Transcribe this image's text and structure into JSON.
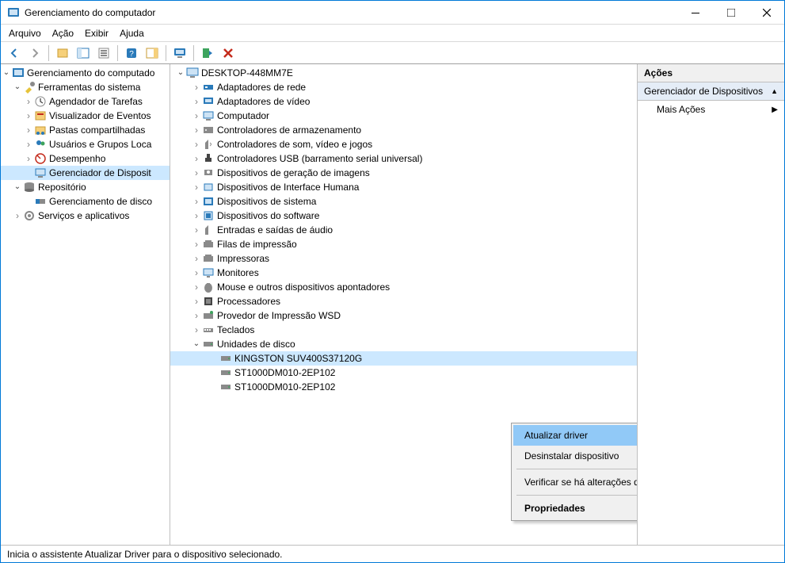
{
  "window": {
    "title": "Gerenciamento do computador"
  },
  "menu": {
    "file": "Arquivo",
    "action": "Ação",
    "view": "Exibir",
    "help": "Ajuda"
  },
  "left_tree": {
    "root": "Gerenciamento do computado",
    "system_tools": {
      "label": "Ferramentas do sistema",
      "task_scheduler": "Agendador de Tarefas",
      "event_viewer": "Visualizador de Eventos",
      "shared_folders": "Pastas compartilhadas",
      "users_groups": "Usuários e Grupos Loca",
      "performance": "Desempenho",
      "device_manager": "Gerenciador de Disposit"
    },
    "storage": {
      "label": "Repositório",
      "disk_mgmt": "Gerenciamento de disco"
    },
    "services_apps": "Serviços e aplicativos"
  },
  "device_tree": {
    "root": "DESKTOP-448MM7E",
    "categories": [
      "Adaptadores de rede",
      "Adaptadores de vídeo",
      "Computador",
      "Controladores de armazenamento",
      "Controladores de som, vídeo e jogos",
      "Controladores USB (barramento serial universal)",
      "Dispositivos de geração de imagens",
      "Dispositivos de Interface Humana",
      "Dispositivos de sistema",
      "Dispositivos do software",
      "Entradas e saídas de áudio",
      "Filas de impressão",
      "Impressoras",
      "Monitores",
      "Mouse e outros dispositivos apontadores",
      "Processadores",
      "Provedor de Impressão WSD",
      "Teclados"
    ],
    "disk_drives": {
      "label": "Unidades de disco",
      "items": [
        "KINGSTON SUV400S37120G",
        "ST1000DM010-2EP102",
        "ST1000DM010-2EP102"
      ]
    }
  },
  "context_menu": {
    "update_driver": "Atualizar driver",
    "uninstall": "Desinstalar dispositivo",
    "scan_hw": "Verificar se há alterações de hardware",
    "properties": "Propriedades"
  },
  "actions_pane": {
    "header": "Ações",
    "section": "Gerenciador de Dispositivos",
    "more_actions": "Mais Ações"
  },
  "statusbar": {
    "text": "Inicia o assistente Atualizar Driver para o dispositivo selecionado."
  }
}
